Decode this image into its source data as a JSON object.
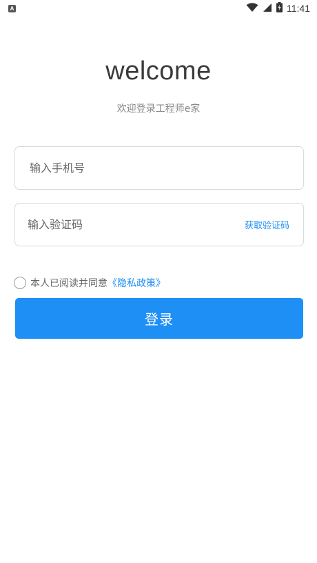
{
  "status_bar": {
    "time": "11:41",
    "notification_icon": "A",
    "icons": [
      "wifi-icon",
      "signal-icon",
      "battery-icon"
    ]
  },
  "header": {
    "title": "welcome",
    "subtitle": "欢迎登录工程师e家"
  },
  "form": {
    "phone_placeholder": "输入手机号",
    "phone_value": "",
    "code_placeholder": "输入验证码",
    "code_value": "",
    "get_code_label": "获取验证码",
    "agreement_text": "本人已阅读并同意",
    "policy_link": "《隐私政策》",
    "agreement_checked": false,
    "login_label": "登录"
  },
  "colors": {
    "accent": "#1e8ff5",
    "border": "#d9d9d9",
    "title": "#3a3a3a",
    "subtitle": "#8a8a8a"
  }
}
